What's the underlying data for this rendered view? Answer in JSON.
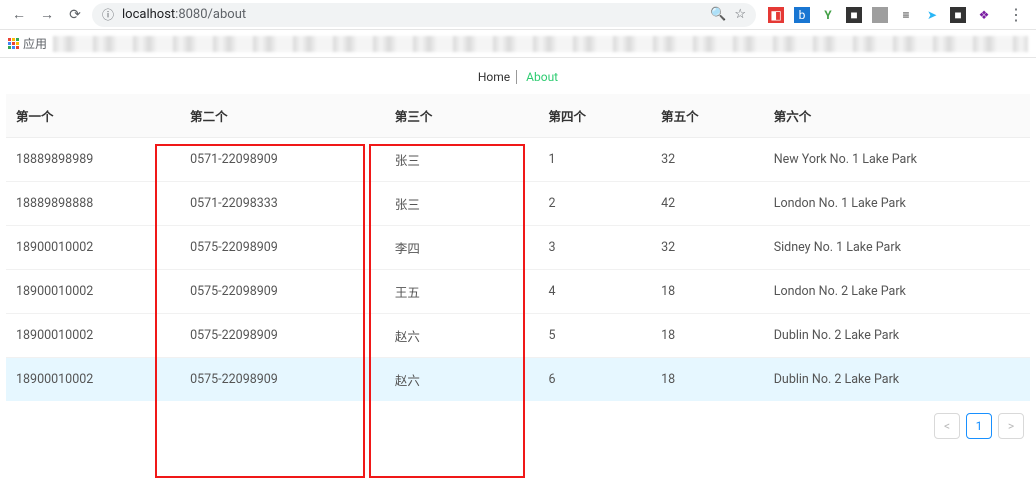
{
  "browser": {
    "url_host": "localhost",
    "url_rest": ":8080/about",
    "apps_label": "应用"
  },
  "nav": {
    "home": "Home",
    "about": "About"
  },
  "table": {
    "headers": [
      "第一个",
      "第二个",
      "第三个",
      "第四个",
      "第五个",
      "第六个"
    ],
    "rows": [
      {
        "c": [
          "18889898989",
          "0571-22098909",
          "张三",
          "1",
          "32",
          "New York No. 1 Lake Park"
        ],
        "hover": false
      },
      {
        "c": [
          "18889898888",
          "0571-22098333",
          "张三",
          "2",
          "42",
          "London No. 1 Lake Park"
        ],
        "hover": false
      },
      {
        "c": [
          "18900010002",
          "0575-22098909",
          "李四",
          "3",
          "32",
          "Sidney No. 1 Lake Park"
        ],
        "hover": false
      },
      {
        "c": [
          "18900010002",
          "0575-22098909",
          "王五",
          "4",
          "18",
          "London No. 2 Lake Park"
        ],
        "hover": false
      },
      {
        "c": [
          "18900010002",
          "0575-22098909",
          "赵六",
          "5",
          "18",
          "Dublin No. 2 Lake Park"
        ],
        "hover": false
      },
      {
        "c": [
          "18900010002",
          "0575-22098909",
          "赵六",
          "6",
          "18",
          "Dublin No. 2 Lake Park"
        ],
        "hover": true
      }
    ]
  },
  "pagination": {
    "current": "1"
  }
}
